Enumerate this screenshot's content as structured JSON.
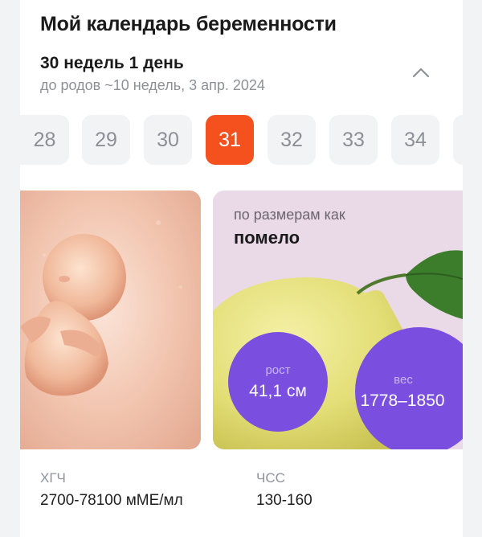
{
  "header": {
    "title": "Мой календарь беременности",
    "week_main": "30 недель 1 день",
    "week_sub": "до родов ~10 недель, 3 апр. 2024",
    "toggle_icon": "chevron-up-icon"
  },
  "week_selector": {
    "weeks": [
      "28",
      "29",
      "30",
      "31",
      "32",
      "33",
      "34"
    ],
    "selected": "31",
    "accent_color": "#f4511e"
  },
  "size_card": {
    "caption": "по размерам как",
    "fruit": "помело",
    "height_label": "рост",
    "height_value": "41,1 см",
    "weight_label": "вес",
    "weight_value": "1778–1850",
    "bubble_color": "#7a4fe0"
  },
  "stats": {
    "hcg_label": "ХГЧ",
    "hcg_value": "2700-78100 мМЕ/мл",
    "hr_label": "ЧСС",
    "hr_value": "130-160"
  }
}
